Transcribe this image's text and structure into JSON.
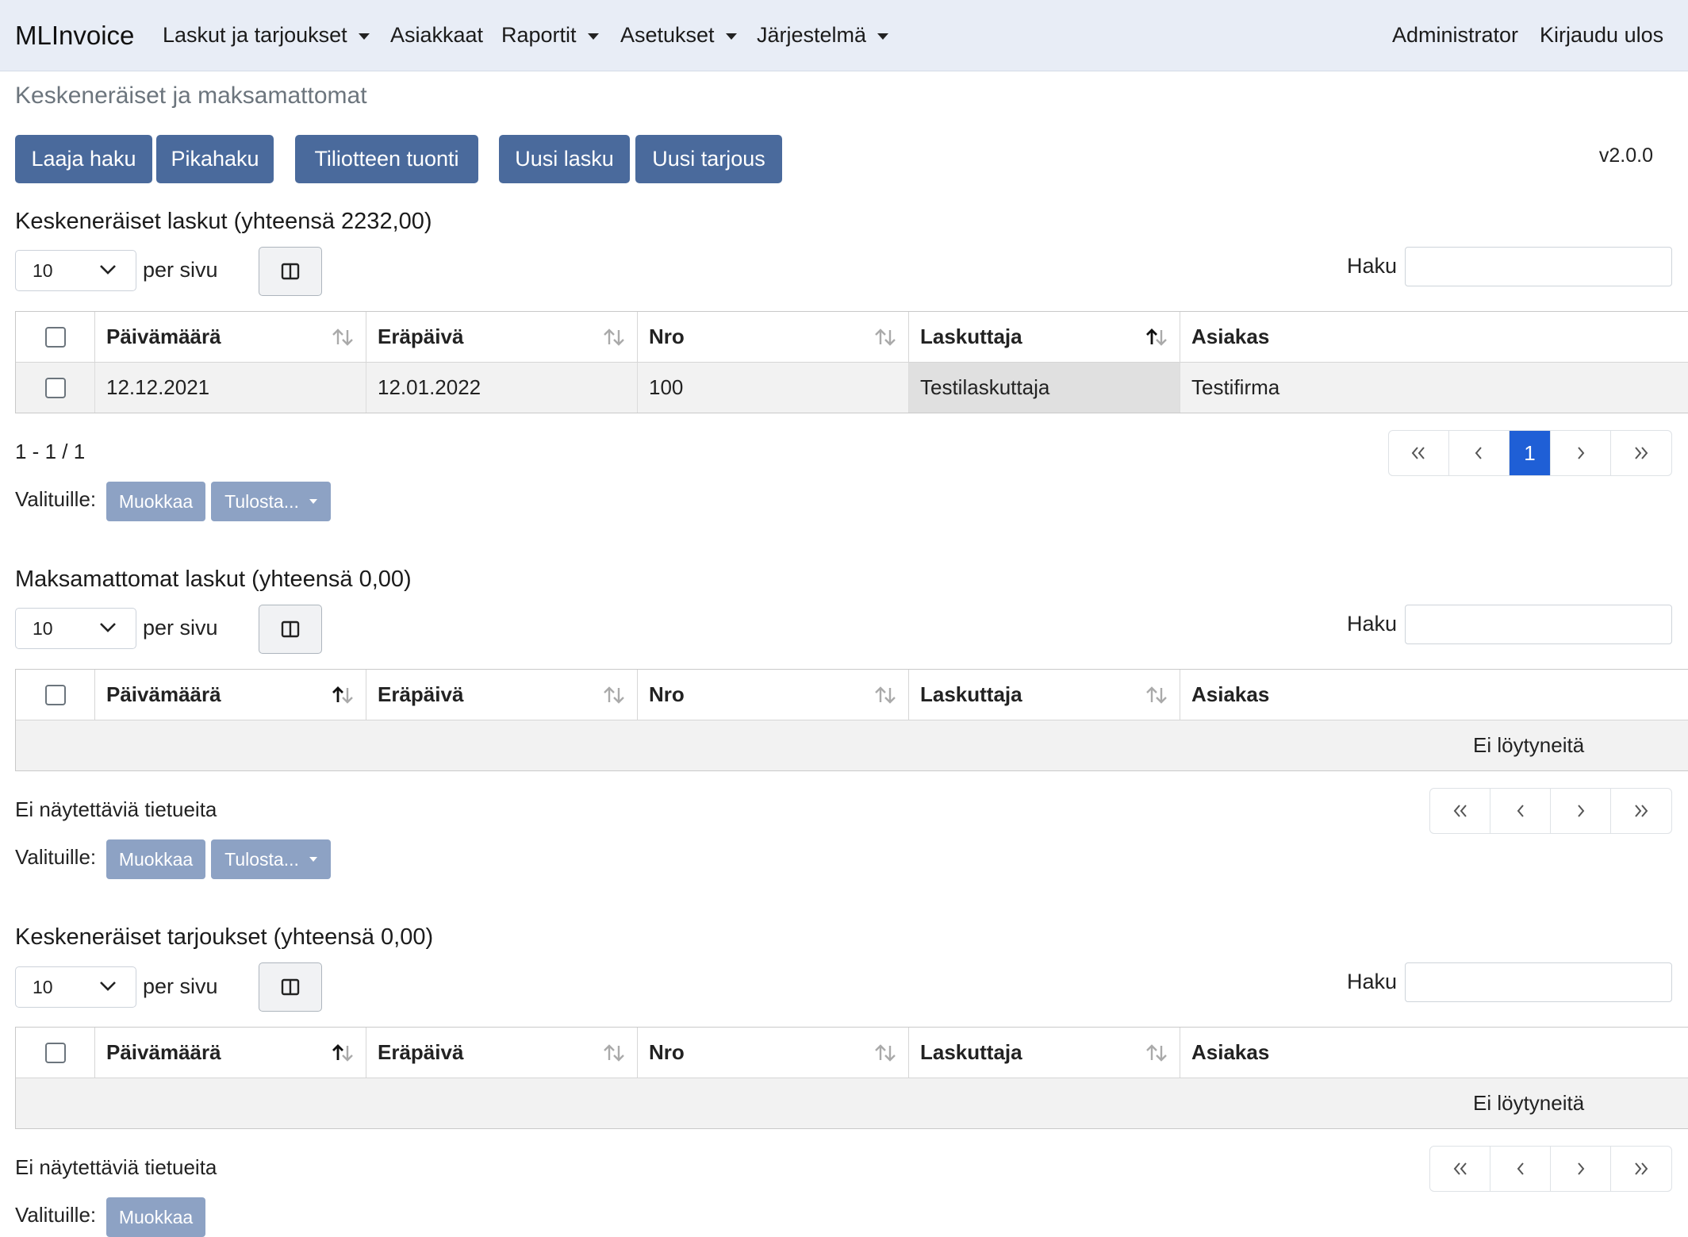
{
  "navbar": {
    "brand": "MLInvoice",
    "menu": [
      {
        "label": "Laskut ja tarjoukset"
      },
      {
        "label": "Asiakkaat"
      },
      {
        "label": "Raportit"
      },
      {
        "label": "Asetukset"
      },
      {
        "label": "Järjestelmä"
      }
    ],
    "user": "Administrator",
    "logout": "Kirjaudu ulos"
  },
  "page": {
    "title": "Keskeneräiset ja maksamattomat",
    "version": "v2.0.0",
    "buttons": {
      "advanced_search": "Laaja haku",
      "quick_search": "Pikahaku",
      "statement_import": "Tiliotteen tuonti",
      "new_invoice": "Uusi lasku",
      "new_offer": "Uusi tarjous"
    }
  },
  "common": {
    "page_size": "10",
    "per_page": "per sivu",
    "search_label": "Haku",
    "for_selected": "Valituille:",
    "edit": "Muokkaa",
    "print": "Tulosta...",
    "no_results": "Ei löytyneitä",
    "no_records": "Ei näytettäviä tietueita"
  },
  "columns": [
    "Päivämäärä",
    "Eräpäivä",
    "Nro",
    "Laskuttaja",
    "Asiakas"
  ],
  "sections": [
    {
      "title": "Keskeneräiset laskut (yhteensä 2232,00)",
      "sorted_column": "Laskuttaja",
      "rows": [
        {
          "date": "12.12.2021",
          "due": "12.01.2022",
          "nro": "100",
          "biller": "Testilaskuttaja",
          "customer": "Testifirma"
        }
      ],
      "info": "1 - 1 / 1",
      "current_page": "1"
    },
    {
      "title": "Maksamattomat laskut (yhteensä 0,00)",
      "sorted_column": "Päivämäärä",
      "rows": [],
      "info": "Ei näytettäviä tietueita"
    },
    {
      "title": "Keskeneräiset tarjoukset (yhteensä 0,00)",
      "sorted_column": "Päivämäärä",
      "rows": [],
      "info": "Ei näytettäviä tietueita"
    }
  ],
  "icons": {
    "column_toggle": "columns-icon",
    "sort": "sort-arrows-icon",
    "pager": [
      "first-page-icon",
      "prev-page-icon",
      "next-page-icon",
      "last-page-icon"
    ]
  },
  "colors": {
    "navbar_bg": "#e8edf6",
    "primary_button": "#4a6a9c",
    "disabled_button": "#8da2c4",
    "active_page": "#1f5fd6"
  }
}
